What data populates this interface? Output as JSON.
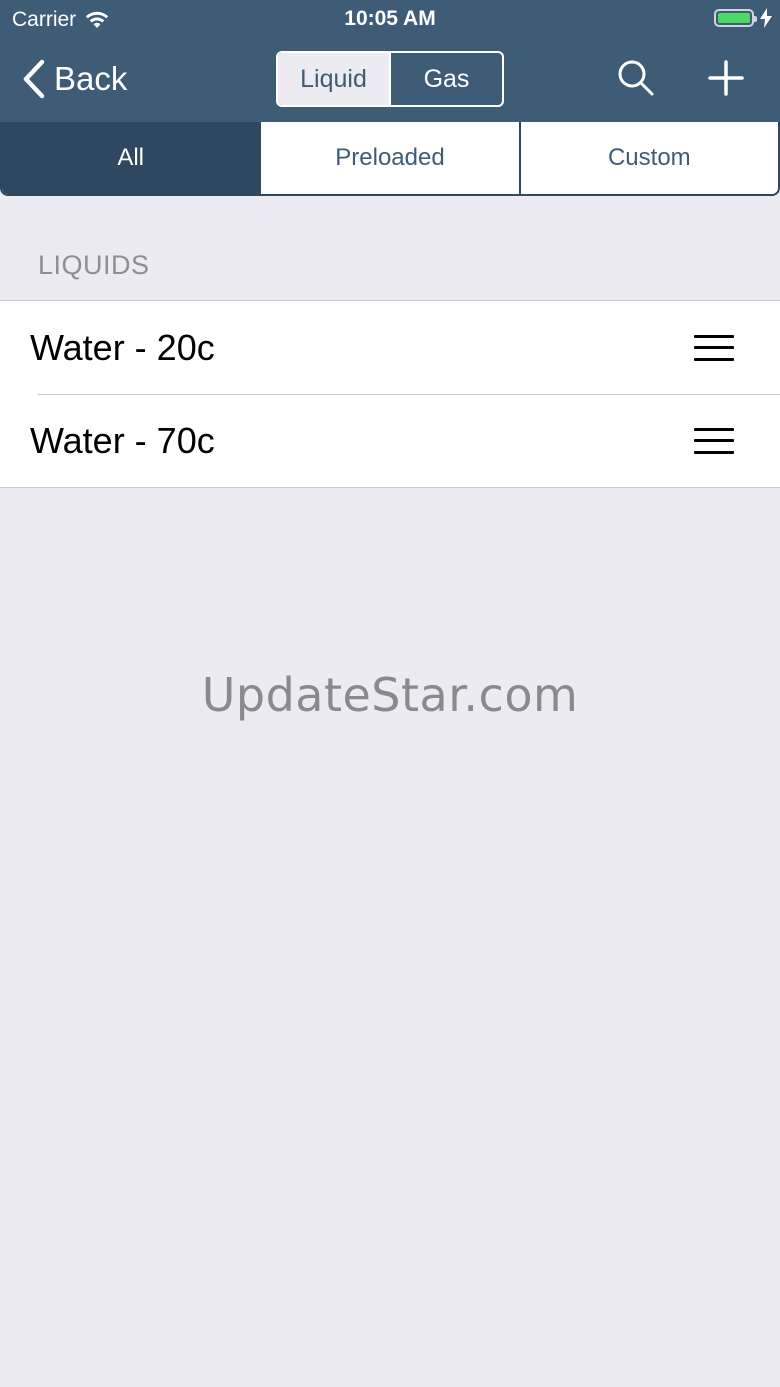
{
  "status_bar": {
    "carrier": "Carrier",
    "time": "10:05 AM",
    "battery_color": "#4cd964"
  },
  "nav": {
    "back_label": "Back",
    "segments": [
      {
        "label": "Liquid",
        "selected": true
      },
      {
        "label": "Gas",
        "selected": false
      }
    ],
    "icons": [
      "search-icon",
      "plus-icon"
    ],
    "background_color": "#3f5c77"
  },
  "filter_tabs": [
    {
      "label": "All",
      "selected": true
    },
    {
      "label": "Preloaded",
      "selected": false
    },
    {
      "label": "Custom",
      "selected": false
    }
  ],
  "section": {
    "header": "LIQUIDS",
    "items": [
      {
        "name": "Water - 20c"
      },
      {
        "name": "Water - 70c"
      }
    ]
  },
  "watermark": "UpdateStar.com"
}
